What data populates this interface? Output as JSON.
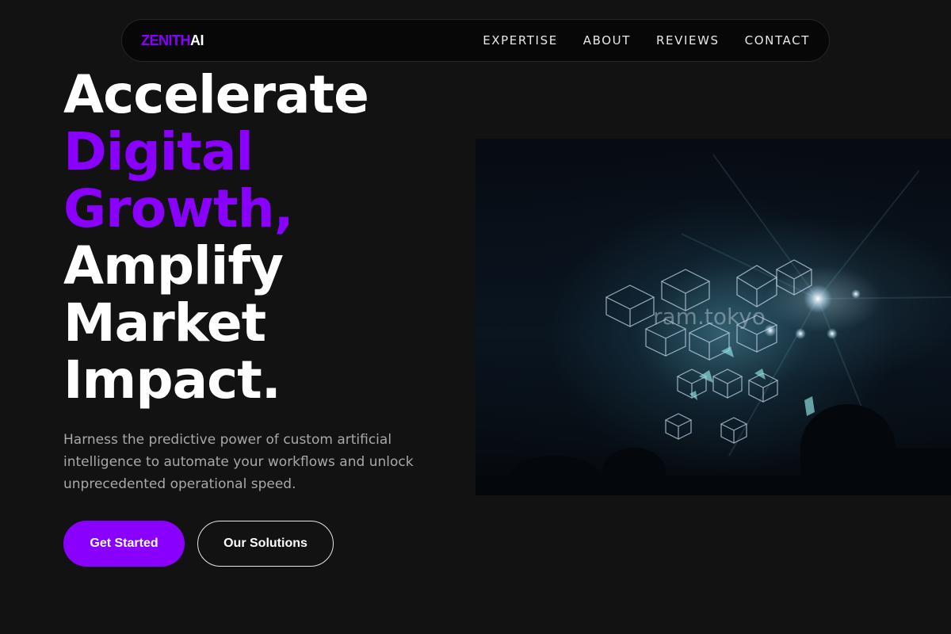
{
  "brand": {
    "logo_part1": "ZENITH",
    "logo_part2": "AI",
    "accent_color": "#8a00ff"
  },
  "nav": {
    "items": [
      {
        "label": "EXPERTISE"
      },
      {
        "label": "ABOUT"
      },
      {
        "label": "REVIEWS"
      },
      {
        "label": "CONTACT"
      }
    ]
  },
  "hero": {
    "title_lines": [
      {
        "text": "Accelerate",
        "accent": false
      },
      {
        "text": "Digital",
        "accent": true
      },
      {
        "text": "Growth,",
        "accent": true
      },
      {
        "text": "Amplify",
        "accent": false
      },
      {
        "text": "Market",
        "accent": false
      },
      {
        "text": "Impact.",
        "accent": false
      }
    ],
    "subtitle": "Harness the predictive power of custom artificial intelligence to automate your workflows and unlock unprecedented operational speed.",
    "primary_button": "Get Started",
    "secondary_button": "Our Solutions",
    "image_watermark": "ram.tokyo"
  }
}
